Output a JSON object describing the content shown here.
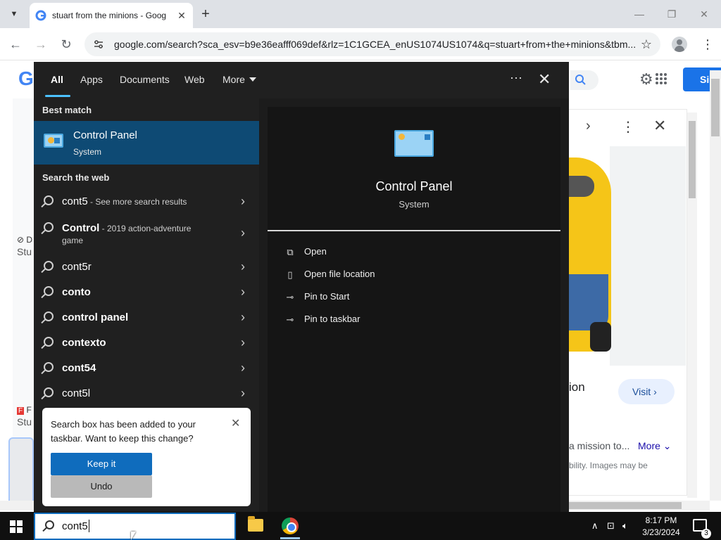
{
  "browser": {
    "tab_title": "stuart from the minions - Goog",
    "url": "google.com/search?sca_esv=b9e36eafff069def&rlz=1C1GCEA_enUS1074US1074&q=stuart+from+the+minions&tbm...",
    "signin_label": "Si"
  },
  "page_bg": {
    "left_d": "D",
    "left_stu": "Stu",
    "left_f": "F",
    "left_stu2": "Stu",
    "right_ion": "ion",
    "visit_label": "Visit",
    "mission_text": "a mission to...",
    "more_label": "More",
    "bility_text": "bility. Images may be"
  },
  "search_menu": {
    "tabs": [
      "All",
      "Apps",
      "Documents",
      "Web",
      "More"
    ],
    "best_match_heading": "Best match",
    "best_match": {
      "title": "Control Panel",
      "subtitle": "System"
    },
    "web_heading": "Search the web",
    "web_results": [
      {
        "main": "cont5",
        "extra": " - See more search results",
        "bold": false
      },
      {
        "main": "Control",
        "extra": " - 2019 action-adventure",
        "extra2": "game",
        "bold": true
      },
      {
        "main": "cont5r",
        "extra": "",
        "bold": false
      },
      {
        "main": "conto",
        "extra": "",
        "bold": true
      },
      {
        "main": "control panel",
        "extra": "",
        "bold": true
      },
      {
        "main": "contexto",
        "extra": "",
        "bold": true
      },
      {
        "main": "cont54",
        "extra": "",
        "bold": true
      },
      {
        "main": "cont5l",
        "extra": "",
        "bold": false
      }
    ],
    "detail": {
      "title": "Control Panel",
      "subtitle": "System",
      "actions": [
        "Open",
        "Open file location",
        "Pin to Start",
        "Pin to taskbar"
      ]
    }
  },
  "toast": {
    "message": "Search box has been added to your taskbar. Want to keep this change?",
    "keep_label": "Keep it",
    "undo_label": "Undo"
  },
  "taskbar": {
    "search_query": "cont5",
    "time": "8:17 PM",
    "date": "3/23/2024",
    "notification_count": "3"
  },
  "colors": {
    "accent": "#0f6cbd",
    "best_match_bg": "#0e4a74",
    "menu_bg": "#202020",
    "chrome_blue": "#1a73e8"
  }
}
